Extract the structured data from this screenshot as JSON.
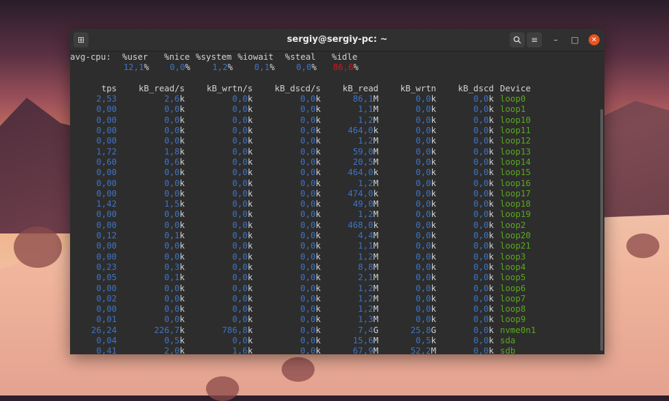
{
  "window": {
    "title": "sergiy@sergiy-pc: ~",
    "new_tab_icon": "new-tab-icon",
    "search_icon": "search-icon",
    "menu_icon": "hamburger-menu-icon",
    "minimize": "–",
    "maximize": "□",
    "close": "✕"
  },
  "cpu": {
    "label": "avg-cpu:",
    "headers": [
      "%user",
      "%nice",
      "%system",
      "%iowait",
      "%steal",
      "%idle"
    ],
    "values": [
      [
        "12,1",
        "%"
      ],
      [
        "0,0",
        "%"
      ],
      [
        "1,2",
        "%"
      ],
      [
        "0,1",
        "%"
      ],
      [
        "0,0",
        "%"
      ],
      [
        "86,6",
        "%"
      ]
    ]
  },
  "device_headers": [
    "tps",
    "kB_read/s",
    "kB_wrtn/s",
    "kB_dscd/s",
    "kB_read",
    "kB_wrtn",
    "kB_dscd",
    "Device"
  ],
  "rows": [
    {
      "tps": "2,53",
      "read_s": [
        "2,6",
        "k"
      ],
      "wrtn_s": [
        "0,0",
        "k"
      ],
      "dscd_s": [
        "0,0",
        "k"
      ],
      "read": [
        "86,1",
        "M"
      ],
      "wrtn": [
        "0,0",
        "k"
      ],
      "dscd": [
        "0,0",
        "k"
      ],
      "device": "loop0"
    },
    {
      "tps": "0,00",
      "read_s": [
        "0,0",
        "k"
      ],
      "wrtn_s": [
        "0,0",
        "k"
      ],
      "dscd_s": [
        "0,0",
        "k"
      ],
      "read": [
        "1,1",
        "M"
      ],
      "wrtn": [
        "0,0",
        "k"
      ],
      "dscd": [
        "0,0",
        "k"
      ],
      "device": "loop1"
    },
    {
      "tps": "0,00",
      "read_s": [
        "0,0",
        "k"
      ],
      "wrtn_s": [
        "0,0",
        "k"
      ],
      "dscd_s": [
        "0,0",
        "k"
      ],
      "read": [
        "1,2",
        "M"
      ],
      "wrtn": [
        "0,0",
        "k"
      ],
      "dscd": [
        "0,0",
        "k"
      ],
      "device": "loop10"
    },
    {
      "tps": "0,00",
      "read_s": [
        "0,0",
        "k"
      ],
      "wrtn_s": [
        "0,0",
        "k"
      ],
      "dscd_s": [
        "0,0",
        "k"
      ],
      "read": [
        "464,0",
        "k"
      ],
      "wrtn": [
        "0,0",
        "k"
      ],
      "dscd": [
        "0,0",
        "k"
      ],
      "device": "loop11"
    },
    {
      "tps": "0,00",
      "read_s": [
        "0,0",
        "k"
      ],
      "wrtn_s": [
        "0,0",
        "k"
      ],
      "dscd_s": [
        "0,0",
        "k"
      ],
      "read": [
        "1,2",
        "M"
      ],
      "wrtn": [
        "0,0",
        "k"
      ],
      "dscd": [
        "0,0",
        "k"
      ],
      "device": "loop12"
    },
    {
      "tps": "1,72",
      "read_s": [
        "1,8",
        "k"
      ],
      "wrtn_s": [
        "0,0",
        "k"
      ],
      "dscd_s": [
        "0,0",
        "k"
      ],
      "read": [
        "59,0",
        "M"
      ],
      "wrtn": [
        "0,0",
        "k"
      ],
      "dscd": [
        "0,0",
        "k"
      ],
      "device": "loop13"
    },
    {
      "tps": "0,60",
      "read_s": [
        "0,6",
        "k"
      ],
      "wrtn_s": [
        "0,0",
        "k"
      ],
      "dscd_s": [
        "0,0",
        "k"
      ],
      "read": [
        "20,5",
        "M"
      ],
      "wrtn": [
        "0,0",
        "k"
      ],
      "dscd": [
        "0,0",
        "k"
      ],
      "device": "loop14"
    },
    {
      "tps": "0,00",
      "read_s": [
        "0,0",
        "k"
      ],
      "wrtn_s": [
        "0,0",
        "k"
      ],
      "dscd_s": [
        "0,0",
        "k"
      ],
      "read": [
        "464,0",
        "k"
      ],
      "wrtn": [
        "0,0",
        "k"
      ],
      "dscd": [
        "0,0",
        "k"
      ],
      "device": "loop15"
    },
    {
      "tps": "0,00",
      "read_s": [
        "0,0",
        "k"
      ],
      "wrtn_s": [
        "0,0",
        "k"
      ],
      "dscd_s": [
        "0,0",
        "k"
      ],
      "read": [
        "1,2",
        "M"
      ],
      "wrtn": [
        "0,0",
        "k"
      ],
      "dscd": [
        "0,0",
        "k"
      ],
      "device": "loop16"
    },
    {
      "tps": "0,00",
      "read_s": [
        "0,0",
        "k"
      ],
      "wrtn_s": [
        "0,0",
        "k"
      ],
      "dscd_s": [
        "0,0",
        "k"
      ],
      "read": [
        "474,0",
        "k"
      ],
      "wrtn": [
        "0,0",
        "k"
      ],
      "dscd": [
        "0,0",
        "k"
      ],
      "device": "loop17"
    },
    {
      "tps": "1,42",
      "read_s": [
        "1,5",
        "k"
      ],
      "wrtn_s": [
        "0,0",
        "k"
      ],
      "dscd_s": [
        "0,0",
        "k"
      ],
      "read": [
        "49,0",
        "M"
      ],
      "wrtn": [
        "0,0",
        "k"
      ],
      "dscd": [
        "0,0",
        "k"
      ],
      "device": "loop18"
    },
    {
      "tps": "0,00",
      "read_s": [
        "0,0",
        "k"
      ],
      "wrtn_s": [
        "0,0",
        "k"
      ],
      "dscd_s": [
        "0,0",
        "k"
      ],
      "read": [
        "1,2",
        "M"
      ],
      "wrtn": [
        "0,0",
        "k"
      ],
      "dscd": [
        "0,0",
        "k"
      ],
      "device": "loop19"
    },
    {
      "tps": "0,00",
      "read_s": [
        "0,0",
        "k"
      ],
      "wrtn_s": [
        "0,0",
        "k"
      ],
      "dscd_s": [
        "0,0",
        "k"
      ],
      "read": [
        "468,0",
        "k"
      ],
      "wrtn": [
        "0,0",
        "k"
      ],
      "dscd": [
        "0,0",
        "k"
      ],
      "device": "loop2"
    },
    {
      "tps": "0,12",
      "read_s": [
        "0,1",
        "k"
      ],
      "wrtn_s": [
        "0,0",
        "k"
      ],
      "dscd_s": [
        "0,0",
        "k"
      ],
      "read": [
        "4,4",
        "M"
      ],
      "wrtn": [
        "0,0",
        "k"
      ],
      "dscd": [
        "0,0",
        "k"
      ],
      "device": "loop20"
    },
    {
      "tps": "0,00",
      "read_s": [
        "0,0",
        "k"
      ],
      "wrtn_s": [
        "0,0",
        "k"
      ],
      "dscd_s": [
        "0,0",
        "k"
      ],
      "read": [
        "1,1",
        "M"
      ],
      "wrtn": [
        "0,0",
        "k"
      ],
      "dscd": [
        "0,0",
        "k"
      ],
      "device": "loop21"
    },
    {
      "tps": "0,00",
      "read_s": [
        "0,0",
        "k"
      ],
      "wrtn_s": [
        "0,0",
        "k"
      ],
      "dscd_s": [
        "0,0",
        "k"
      ],
      "read": [
        "1,2",
        "M"
      ],
      "wrtn": [
        "0,0",
        "k"
      ],
      "dscd": [
        "0,0",
        "k"
      ],
      "device": "loop3"
    },
    {
      "tps": "0,23",
      "read_s": [
        "0,3",
        "k"
      ],
      "wrtn_s": [
        "0,0",
        "k"
      ],
      "dscd_s": [
        "0,0",
        "k"
      ],
      "read": [
        "8,8",
        "M"
      ],
      "wrtn": [
        "0,0",
        "k"
      ],
      "dscd": [
        "0,0",
        "k"
      ],
      "device": "loop4"
    },
    {
      "tps": "0,05",
      "read_s": [
        "0,1",
        "k"
      ],
      "wrtn_s": [
        "0,0",
        "k"
      ],
      "dscd_s": [
        "0,0",
        "k"
      ],
      "read": [
        "2,1",
        "M"
      ],
      "wrtn": [
        "0,0",
        "k"
      ],
      "dscd": [
        "0,0",
        "k"
      ],
      "device": "loop5"
    },
    {
      "tps": "0,00",
      "read_s": [
        "0,0",
        "k"
      ],
      "wrtn_s": [
        "0,0",
        "k"
      ],
      "dscd_s": [
        "0,0",
        "k"
      ],
      "read": [
        "1,2",
        "M"
      ],
      "wrtn": [
        "0,0",
        "k"
      ],
      "dscd": [
        "0,0",
        "k"
      ],
      "device": "loop6"
    },
    {
      "tps": "0,02",
      "read_s": [
        "0,0",
        "k"
      ],
      "wrtn_s": [
        "0,0",
        "k"
      ],
      "dscd_s": [
        "0,0",
        "k"
      ],
      "read": [
        "1,2",
        "M"
      ],
      "wrtn": [
        "0,0",
        "k"
      ],
      "dscd": [
        "0,0",
        "k"
      ],
      "device": "loop7"
    },
    {
      "tps": "0,00",
      "read_s": [
        "0,0",
        "k"
      ],
      "wrtn_s": [
        "0,0",
        "k"
      ],
      "dscd_s": [
        "0,0",
        "k"
      ],
      "read": [
        "1,2",
        "M"
      ],
      "wrtn": [
        "0,0",
        "k"
      ],
      "dscd": [
        "0,0",
        "k"
      ],
      "device": "loop8"
    },
    {
      "tps": "0,01",
      "read_s": [
        "0,0",
        "k"
      ],
      "wrtn_s": [
        "0,0",
        "k"
      ],
      "dscd_s": [
        "0,0",
        "k"
      ],
      "read": [
        "1,3",
        "M"
      ],
      "wrtn": [
        "0,0",
        "k"
      ],
      "dscd": [
        "0,0",
        "k"
      ],
      "device": "loop9"
    },
    {
      "tps": "26,24",
      "read_s": [
        "226,7",
        "k"
      ],
      "wrtn_s": [
        "786,8",
        "k"
      ],
      "dscd_s": [
        "0,0",
        "k"
      ],
      "read": [
        "7,4",
        "G"
      ],
      "wrtn": [
        "25,8",
        "G"
      ],
      "dscd": [
        "0,0",
        "k"
      ],
      "device": "nvme0n1"
    },
    {
      "tps": "0,04",
      "read_s": [
        "0,5",
        "k"
      ],
      "wrtn_s": [
        "0,0",
        "k"
      ],
      "dscd_s": [
        "0,0",
        "k"
      ],
      "read": [
        "15,6",
        "M"
      ],
      "wrtn": [
        "0,5",
        "k"
      ],
      "dscd": [
        "0,0",
        "k"
      ],
      "device": "sda"
    },
    {
      "tps": "0,41",
      "read_s": [
        "2,0",
        "k"
      ],
      "wrtn_s": [
        "1,6",
        "k"
      ],
      "dscd_s": [
        "0,0",
        "k"
      ],
      "read": [
        "67,9",
        "M"
      ],
      "wrtn": [
        "52,2",
        "M"
      ],
      "dscd": [
        "0,0",
        "k"
      ],
      "device": "sdb"
    }
  ],
  "colors": {
    "value_blue": "#3d74c4",
    "device_green": "#5aa81e",
    "idle_red": "#cc1b1b",
    "accent_close": "#e95420"
  }
}
